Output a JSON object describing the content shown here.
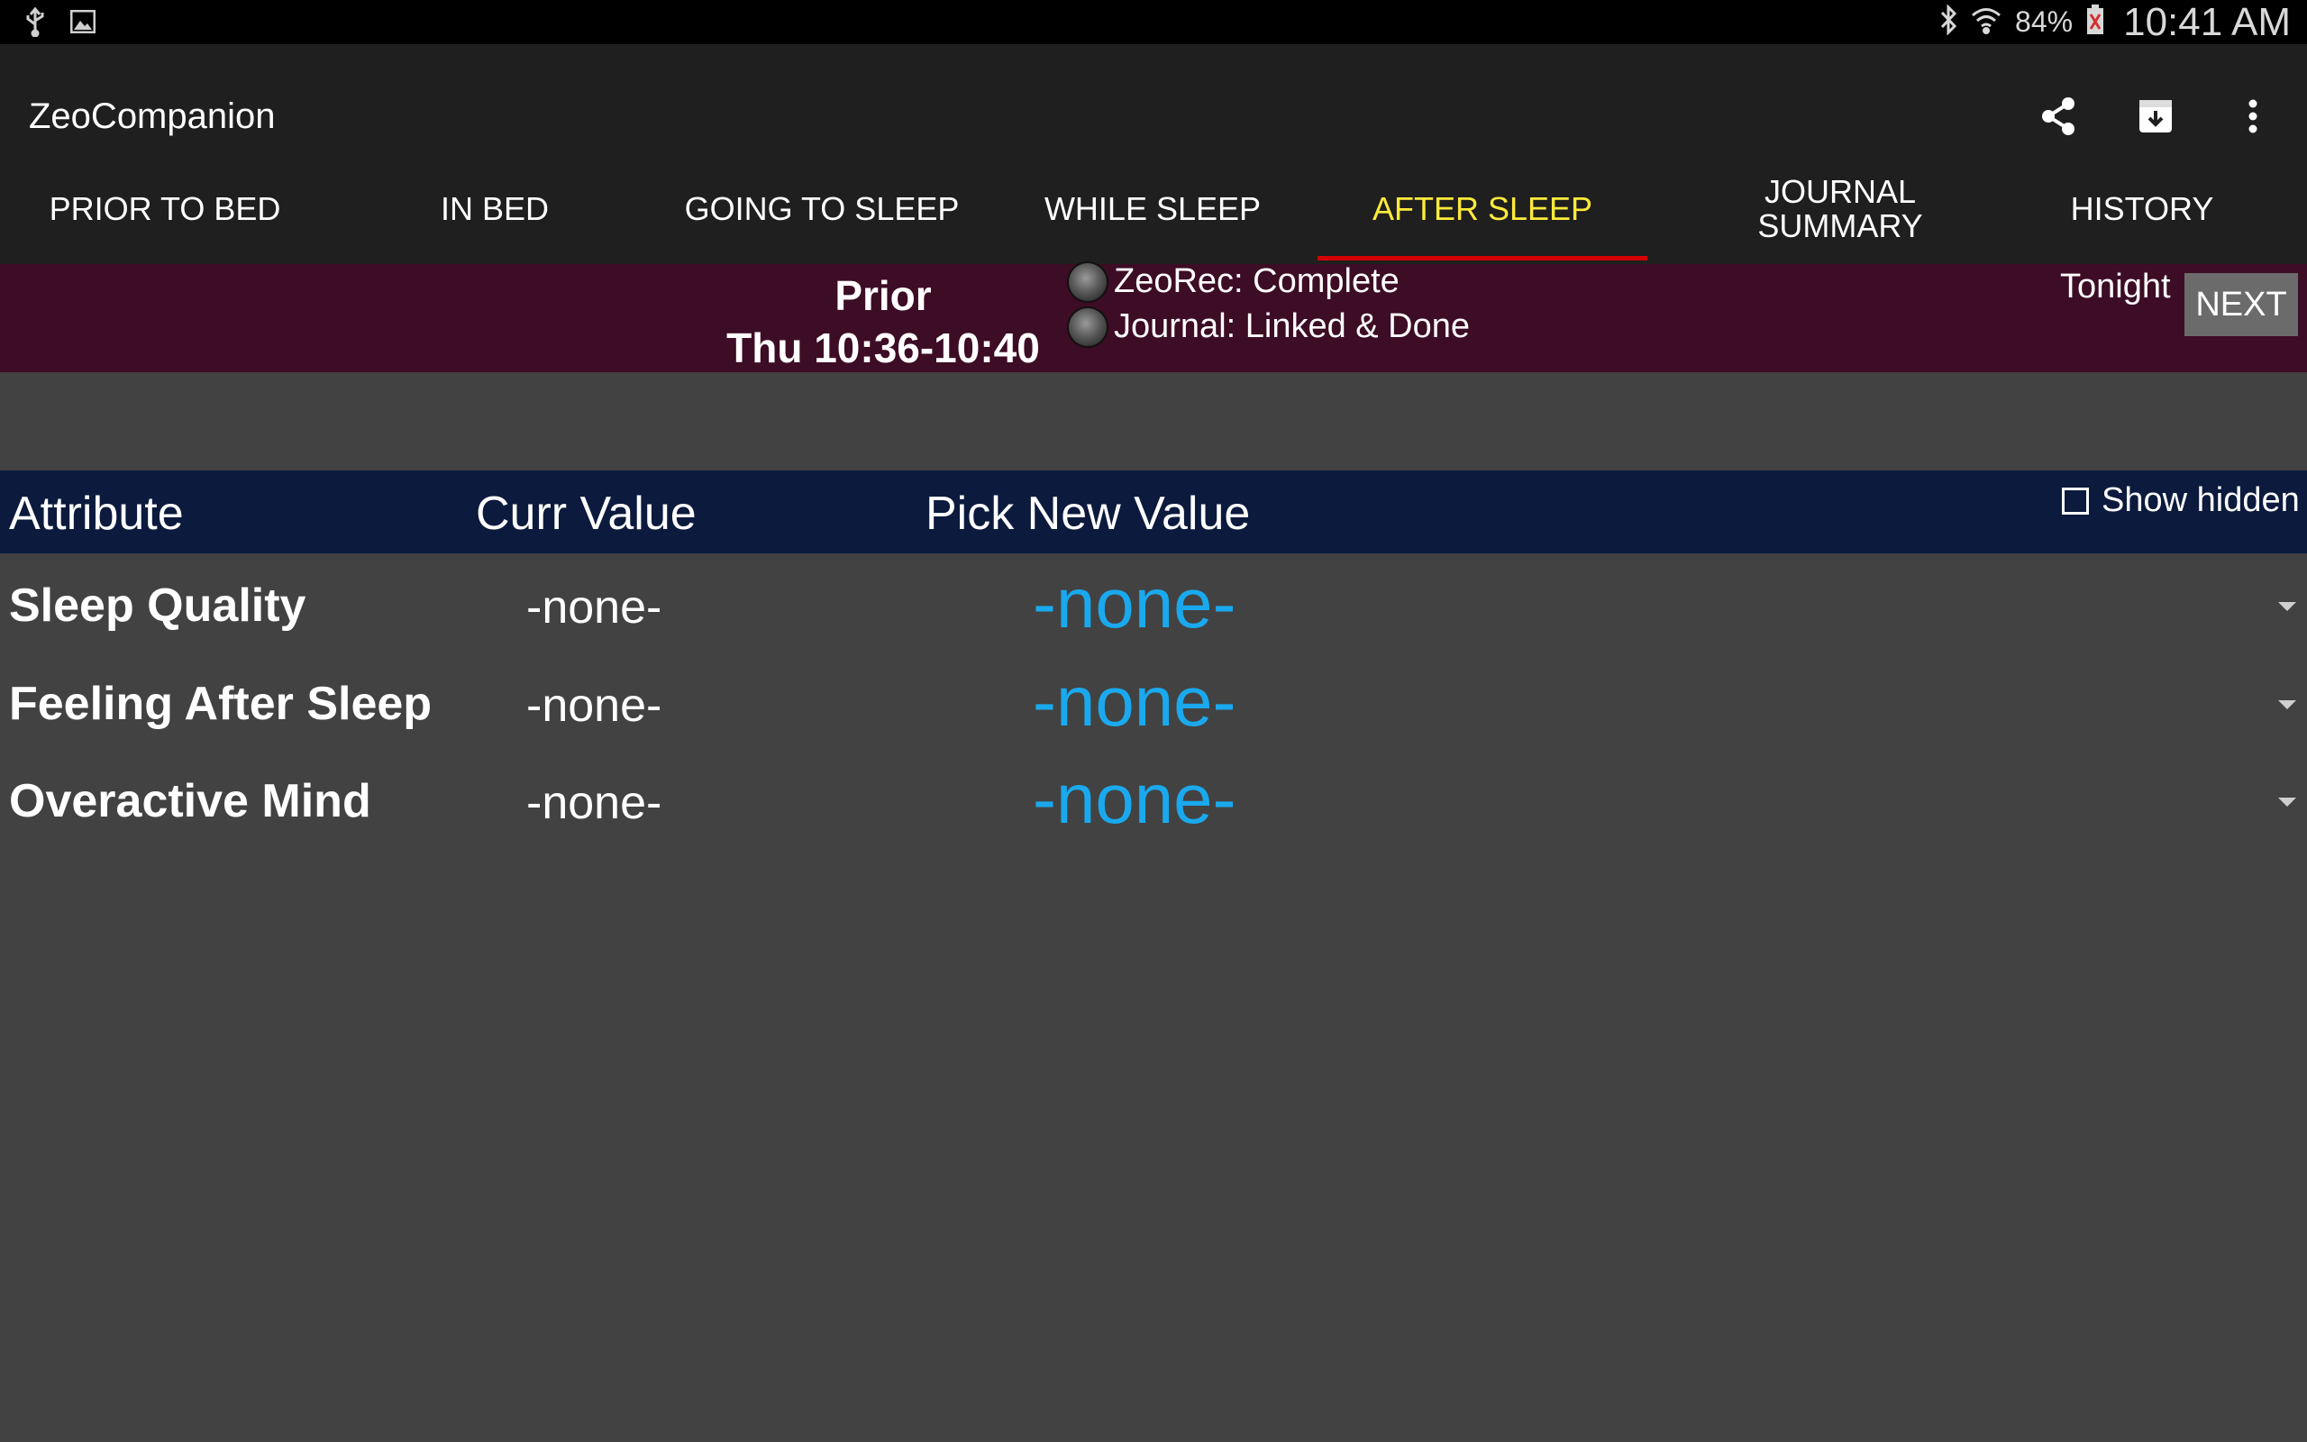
{
  "status_bar": {
    "left_icons": [
      "usb-icon",
      "image-icon"
    ],
    "right_icons": [
      "bluetooth-icon",
      "wifi-icon",
      "battery-icon"
    ],
    "battery_percent": "84%",
    "time": "10:41 AM"
  },
  "app": {
    "title": "ZeoCompanion",
    "actions": [
      "share-icon",
      "archive-download-icon",
      "overflow-menu-icon"
    ]
  },
  "tabs": [
    {
      "label": "PRIOR TO BED",
      "active": false
    },
    {
      "label": "IN BED",
      "active": false
    },
    {
      "label": "GOING TO SLEEP",
      "active": false
    },
    {
      "label": "WHILE SLEEP",
      "active": false
    },
    {
      "label": "AFTER SLEEP",
      "active": true
    },
    {
      "label": "JOURNAL SUMMARY",
      "active": false
    },
    {
      "label": "HISTORY",
      "active": false
    }
  ],
  "info": {
    "prior_label": "Prior",
    "prior_time": "Thu 10:36-10:40",
    "status1": "ZeoRec: Complete",
    "status2": "Journal: Linked & Done",
    "tonight_label": "Tonight",
    "next_label": "NEXT"
  },
  "table": {
    "col_attribute": "Attribute",
    "col_curr": "Curr Value",
    "col_pick": "Pick New Value",
    "show_hidden_label": "Show hidden",
    "show_hidden_checked": false,
    "rows": [
      {
        "attribute": "Sleep Quality",
        "curr": "-none-",
        "pick": "-none-"
      },
      {
        "attribute": "Feeling After Sleep",
        "curr": "-none-",
        "pick": "-none-"
      },
      {
        "attribute": "Overactive Mind",
        "curr": "-none-",
        "pick": "-none-"
      }
    ]
  },
  "colors": {
    "accent_tab": "#ffeb3b",
    "tab_indicator": "#d50000",
    "info_bar": "#3d0c25",
    "header_bar": "#0c1a3e",
    "picker_text": "#1aa9ee",
    "background": "#424242"
  }
}
